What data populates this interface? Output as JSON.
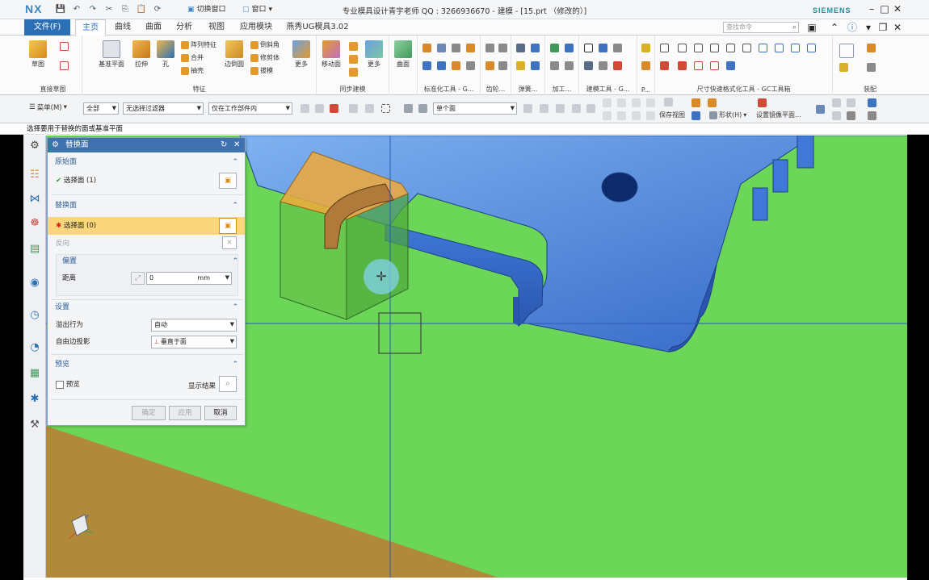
{
  "app": {
    "logo": "NX",
    "window_title": "专业模具设计青宇老师 QQ : 3266936670 - 建模 - [15.prt （修改的）]",
    "brand": "SIEMENS",
    "switch_window": "切换窗口",
    "window_menu": "窗口"
  },
  "tabs": [
    "文件(F)",
    "主页",
    "曲线",
    "曲面",
    "分析",
    "视图",
    "应用模块",
    "燕秀UG模具3.02"
  ],
  "search_placeholder": "查找命令",
  "ribbon": {
    "groups": [
      {
        "label": "直接草图",
        "buttons": [
          "草图"
        ]
      },
      {
        "label": "特征",
        "buttons": [
          "基准平面",
          "拉伸",
          "孔",
          "阵列特征",
          "合并",
          "抽壳",
          "边倒圆",
          "倒斜角",
          "修剪体",
          "拔模",
          "更多"
        ]
      },
      {
        "label": "同步建模",
        "buttons": [
          "移动面",
          "更多"
        ]
      },
      {
        "label": "",
        "buttons": [
          "曲面"
        ]
      },
      {
        "label": "标准化工具 - G...",
        "buttons": []
      },
      {
        "label": "齿轮...",
        "buttons": []
      },
      {
        "label": "弹簧...",
        "buttons": []
      },
      {
        "label": "加工...",
        "buttons": []
      },
      {
        "label": "建模工具 - G...",
        "buttons": []
      },
      {
        "label": "P...",
        "buttons": []
      },
      {
        "label": "尺寸快速格式化工具 - GC工具箱",
        "buttons": []
      },
      {
        "label": "装配",
        "buttons": []
      }
    ]
  },
  "selection_bar": {
    "menu": "菜单(M)",
    "filter_type": "全部",
    "filter": "无选择过滤器",
    "scope": "仅在工作部件内",
    "face_rule": "单个面",
    "save_view": "保存视图",
    "shape": "形状(H)",
    "mirror_plane": "设置镜像平面..."
  },
  "cue_line": "选择要用于替换的面或基准平面",
  "dialog": {
    "title": "替换面",
    "original_face": {
      "header": "原始面",
      "select_label": "选择面 (1)"
    },
    "replacement_face": {
      "header": "替换面",
      "select_label": "选择面 (0)",
      "reverse_label": "反向"
    },
    "offset": {
      "header": "偏置",
      "distance_label": "距离",
      "distance_value": "0",
      "unit": "mm"
    },
    "settings": {
      "header": "设置",
      "overflow_label": "溢出行为",
      "overflow_value": "自动",
      "free_edge_label": "自由边投影",
      "free_edge_value": "垂直于面"
    },
    "preview": {
      "header": "预览",
      "checkbox_label": "预览",
      "show_result": "显示结果"
    },
    "buttons": {
      "ok": "确定",
      "apply": "应用",
      "cancel": "取消"
    }
  },
  "colors": {
    "background_green": "#6bd658",
    "floor": "#b08a3a",
    "part_blue": "#3f78d8",
    "accent": "#2b6fb4",
    "highlight_orange": "#fbd67a"
  }
}
